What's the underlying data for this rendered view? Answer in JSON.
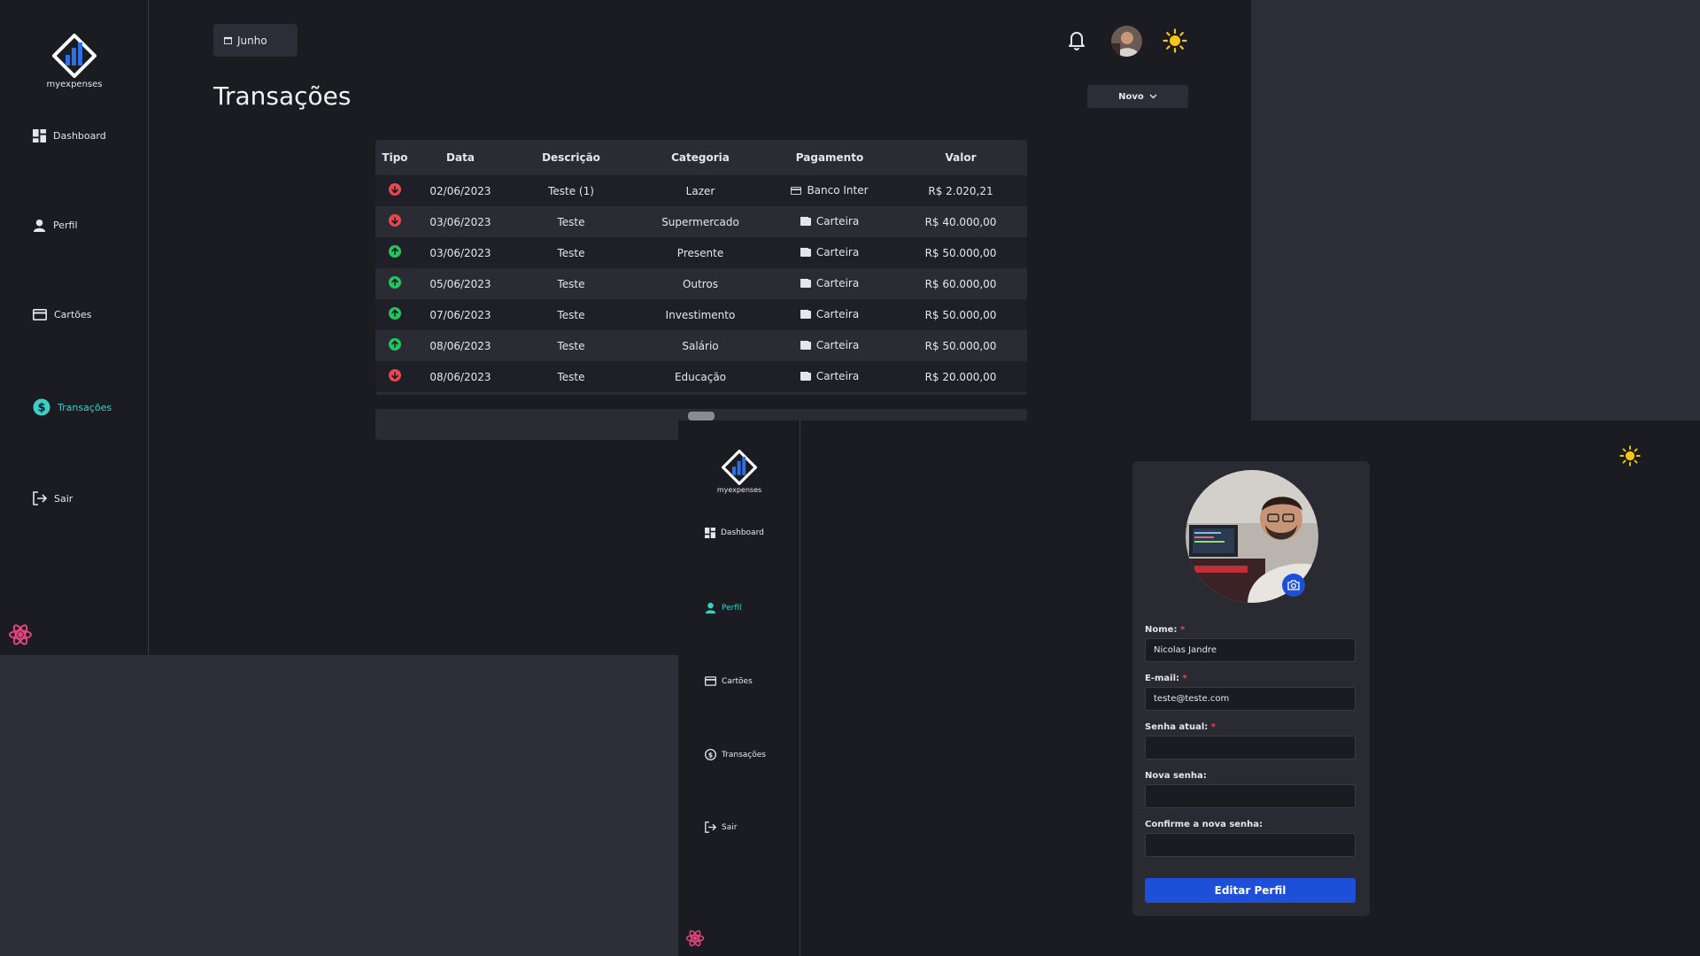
{
  "app": {
    "name": "myexpenses"
  },
  "window1": {
    "sidebar": {
      "items": [
        {
          "label": "Dashboard",
          "icon": "dashboard-icon"
        },
        {
          "label": "Perfil",
          "icon": "user-icon"
        },
        {
          "label": "Cartões",
          "icon": "credit-card-icon"
        },
        {
          "label": "Transações",
          "icon": "dollar-icon",
          "active": true
        },
        {
          "label": "Sair",
          "icon": "logout-icon"
        }
      ]
    },
    "month_button": {
      "label": "Junho",
      "icon": "calendar-icon"
    },
    "title": "Transações",
    "new_button": {
      "label": "Novo"
    },
    "table": {
      "headers": [
        "Tipo",
        "Data",
        "Descrição",
        "Categoria",
        "Pagamento",
        "Valor"
      ],
      "rows": [
        {
          "type": "saida",
          "date": "02/06/2023",
          "description": "Teste (1)",
          "category": "Lazer",
          "payment": "Banco Inter",
          "payment_icon": "credit-card-icon",
          "value": "R$ 2.020,21"
        },
        {
          "type": "saida",
          "date": "03/06/2023",
          "description": "Teste",
          "category": "Supermercado",
          "payment": "Carteira",
          "payment_icon": "wallet-icon",
          "value": "R$ 40.000,00"
        },
        {
          "type": "entrada",
          "date": "03/06/2023",
          "description": "Teste",
          "category": "Presente",
          "payment": "Carteira",
          "payment_icon": "wallet-icon",
          "value": "R$ 50.000,00"
        },
        {
          "type": "entrada",
          "date": "05/06/2023",
          "description": "Teste",
          "category": "Outros",
          "payment": "Carteira",
          "payment_icon": "wallet-icon",
          "value": "R$ 60.000,00"
        },
        {
          "type": "entrada",
          "date": "07/06/2023",
          "description": "Teste",
          "category": "Investimento",
          "payment": "Carteira",
          "payment_icon": "wallet-icon",
          "value": "R$ 50.000,00"
        },
        {
          "type": "entrada",
          "date": "08/06/2023",
          "description": "Teste",
          "category": "Salário",
          "payment": "Carteira",
          "payment_icon": "wallet-icon",
          "value": "R$ 50.000,00"
        },
        {
          "type": "saida",
          "date": "08/06/2023",
          "description": "Teste",
          "category": "Educação",
          "payment": "Carteira",
          "payment_icon": "wallet-icon",
          "value": "R$ 20.000,00"
        }
      ]
    }
  },
  "window2": {
    "sidebar": {
      "items": [
        {
          "label": "Dashboard",
          "icon": "dashboard-icon"
        },
        {
          "label": "Perfil",
          "icon": "user-icon",
          "active": true
        },
        {
          "label": "Cartões",
          "icon": "credit-card-icon"
        },
        {
          "label": "Transações",
          "icon": "dollar-icon"
        },
        {
          "label": "Sair",
          "icon": "logout-icon"
        }
      ]
    },
    "form": {
      "name_label": "Nome:",
      "name_value": "Nicolas Jandre",
      "email_label": "E-mail:",
      "email_value": "teste@teste.com",
      "current_password_label": "Senha atual:",
      "new_password_label": "Nova senha:",
      "confirm_password_label": "Confirme a nova senha:",
      "required_mark": "*",
      "submit_label": "Editar Perfil"
    }
  },
  "colors": {
    "accent": "#3ccfc4",
    "primary_button": "#1d4fd8",
    "income": "#22c55e",
    "expense": "#e5484d",
    "sun": "#f5c518"
  }
}
